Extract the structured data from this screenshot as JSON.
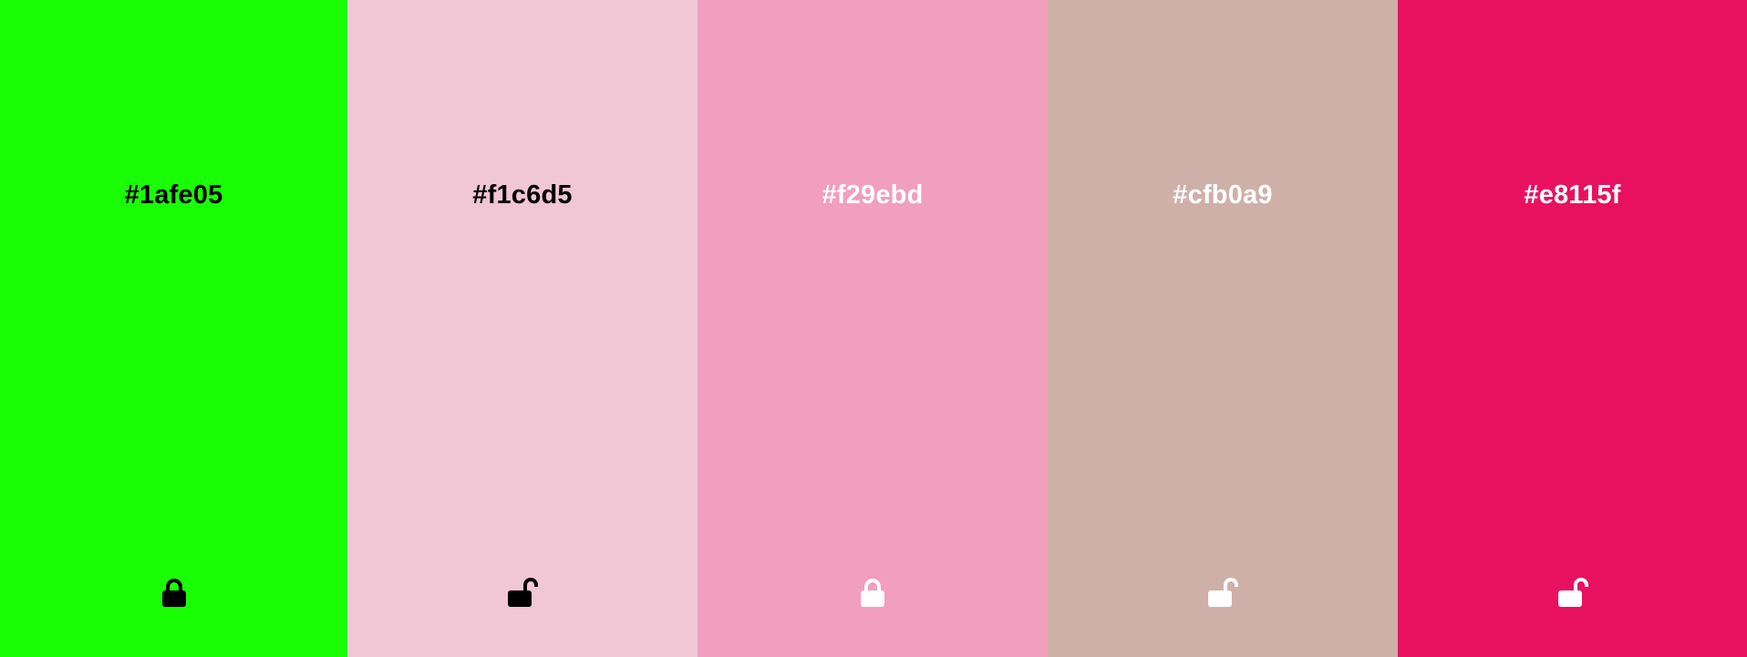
{
  "swatches": [
    {
      "hex": "#1afe05",
      "background": "#1afe05",
      "text_color": "#000000",
      "lock_state": "locked",
      "icon": "lock-closed-icon"
    },
    {
      "hex": "#f1c6d5",
      "background": "#f1c6d5",
      "text_color": "#000000",
      "lock_state": "unlocked",
      "icon": "lock-open-icon"
    },
    {
      "hex": "#f29ebd",
      "background": "#f29ebd",
      "text_color": "#ffffff",
      "lock_state": "locked",
      "icon": "lock-closed-icon"
    },
    {
      "hex": "#cfb0a9",
      "background": "#cfb0a9",
      "text_color": "#ffffff",
      "lock_state": "unlocked",
      "icon": "lock-open-icon"
    },
    {
      "hex": "#e8115f",
      "background": "#e8115f",
      "text_color": "#ffffff",
      "lock_state": "unlocked",
      "icon": "lock-open-icon"
    }
  ]
}
